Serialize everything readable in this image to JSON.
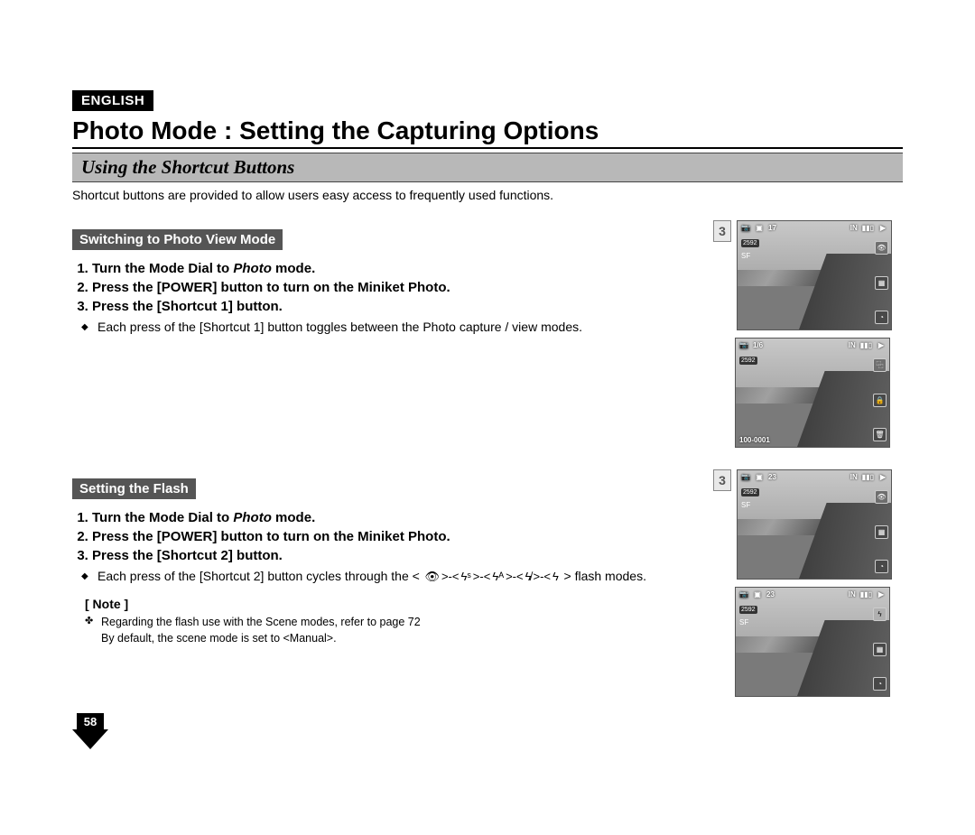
{
  "language_badge": "ENGLISH",
  "page_title": "Photo Mode : Setting the Capturing Options",
  "section_title": "Using the Shortcut Buttons",
  "intro_text": "Shortcut buttons are provided to allow users easy access to frequently used functions.",
  "page_number": "58",
  "block1": {
    "subheader": "Switching to Photo View Mode",
    "step1_a": "Turn the Mode Dial to ",
    "step1_mode": "Photo",
    "step1_b": " mode.",
    "step2": "Press the [POWER] button to turn on the Miniket Photo.",
    "step3": "Press the [Shortcut 1] button.",
    "detail": "Each press of the [Shortcut 1] button toggles between the Photo capture / view modes.",
    "step_figure_num": "3",
    "lcd1": {
      "count": "17",
      "storage": "IN",
      "res": "2592",
      "ext": "SF"
    },
    "lcd2": {
      "count": "1/6",
      "storage": "IN",
      "res": "2592",
      "fileno": "100-0001"
    }
  },
  "block2": {
    "subheader": "Setting the Flash",
    "step1_a": "Turn the Mode Dial to ",
    "step1_mode": "Photo",
    "step1_b": " mode.",
    "step2": "Press the [POWER] button to turn on the Miniket Photo.",
    "step3": "Press the [Shortcut 2] button.",
    "detail_a": "Each press of the [Shortcut 2] button cycles through the <",
    "detail_seq": [
      "👁",
      "ϟˢ",
      "ϟᴬ",
      "ϟ̸",
      "ϟ"
    ],
    "detail_b": "> flash modes.",
    "step_figure_num": "3",
    "lcd3": {
      "count": "23",
      "storage": "IN",
      "res": "2592",
      "ext": "SF"
    },
    "lcd4": {
      "count": "23",
      "storage": "IN",
      "res": "2592",
      "ext": "SF"
    }
  },
  "note": {
    "header": "[ Note ]",
    "line1": "Regarding the flash use with the Scene modes, refer to page 72",
    "line2": "By default, the scene mode is set to <Manual>."
  },
  "icons": {
    "camera": "📷",
    "play": "▶",
    "focus": "▣",
    "eye": "👁",
    "person": "▦",
    "timer": "◔",
    "copy": "⿻",
    "lock": "🔒",
    "trash": "🗑",
    "flash": "ϟ",
    "battery": "▮▮▯"
  }
}
